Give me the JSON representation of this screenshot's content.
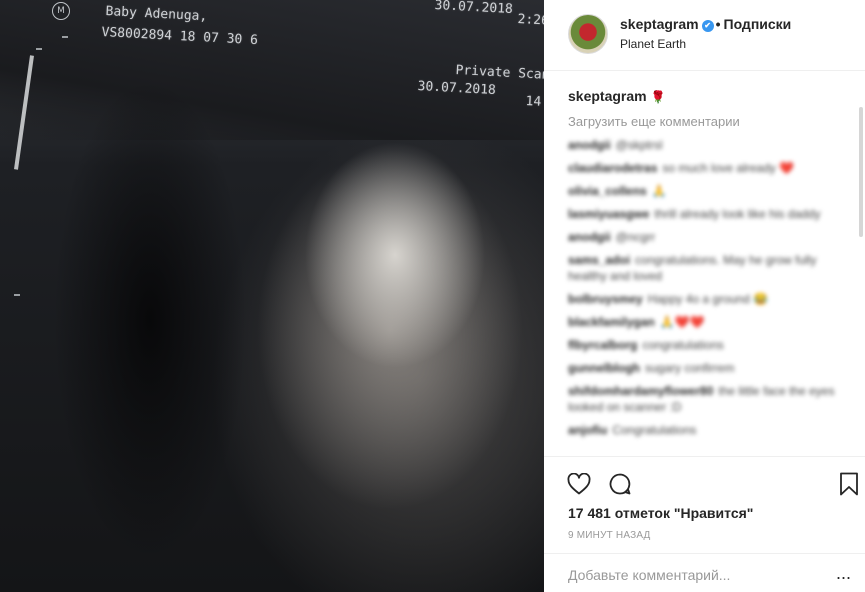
{
  "photo": {
    "scan_logo": "M",
    "patient_name": "Baby Adenuga,",
    "date_top": "30.07.2018",
    "time_top": "2:26",
    "scan_id": "VS8002894 18 07 30 6",
    "scan_type": "Private Scan",
    "date_bottom": "30.07.2018",
    "time_bottom": "14"
  },
  "header": {
    "username": "skeptagram",
    "verified_icon": "✔",
    "separator": "•",
    "follow_label": "Подписки",
    "location": "Planet Earth"
  },
  "caption": {
    "username": "skeptagram",
    "emoji": "🌹"
  },
  "load_more": "Загрузить еще комментарии",
  "comments": [
    {
      "user": "anodgii",
      "text": "@skptrsl"
    },
    {
      "user": "claudiarodetras",
      "text": "so much love already ❤️"
    },
    {
      "user": "olivia_collens",
      "text": "🙏"
    },
    {
      "user": "lasmiyuasgwe",
      "text": "thrill already look like his daddy"
    },
    {
      "user": "anodgii",
      "text": "@ncgrr"
    },
    {
      "user": "sams_adoi",
      "text": "congratulations. May he grow fully healthy and loved"
    },
    {
      "user": "bolbruysmey",
      "text": "Happy 4o a ground 😂"
    },
    {
      "user": "blackfamilygan",
      "text": "🙏❤️❤️"
    },
    {
      "user": "flbyrcalborg",
      "text": "congratulations"
    },
    {
      "user": "gunnelblogh",
      "text": "sugary confirrem"
    },
    {
      "user": "shifdomhardamyflower80",
      "text": "the little face the eyes looked on scanner :D"
    },
    {
      "user": "anjofiu",
      "text": "Congratulations"
    }
  ],
  "actions": {
    "like_icon": "heart-icon",
    "comment_icon": "comment-icon",
    "save_icon": "bookmark-icon",
    "likes_text": "17 481 отметок \"Нравится\"",
    "time_text": "9 МИНУТ НАЗАД",
    "add_comment_placeholder": "Добавьте комментарий...",
    "more_label": "..."
  },
  "colors": {
    "verified": "#3897f0",
    "muted_text": "#999999",
    "border": "#efefef"
  }
}
